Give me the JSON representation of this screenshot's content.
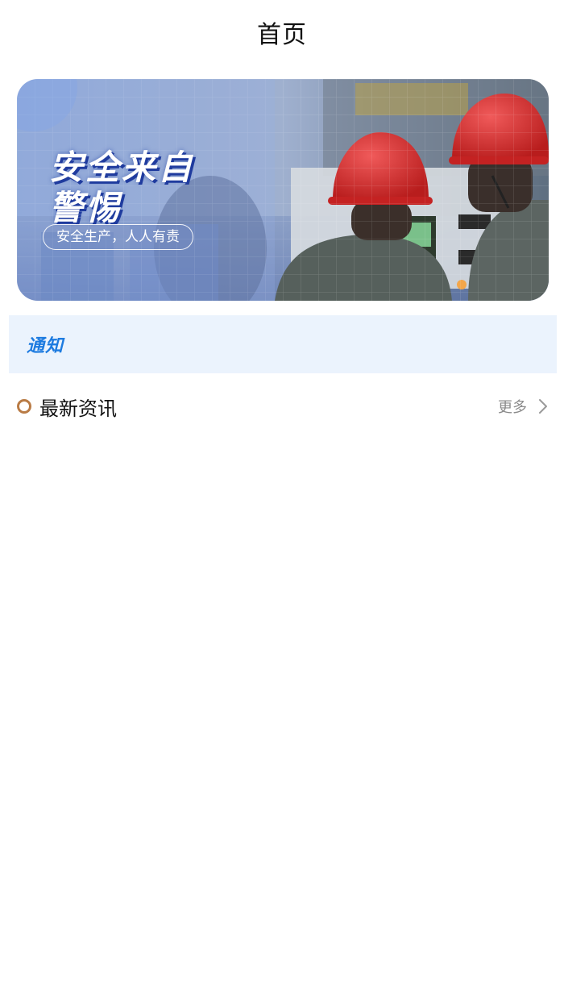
{
  "header": {
    "title": "首页"
  },
  "banner": {
    "title_line1": "安全来自",
    "title_line2": "警惕",
    "slogan": "安全生产，人人有责"
  },
  "notice": {
    "label": "通知"
  },
  "news": {
    "title": "最新资讯",
    "more_label": "更多"
  },
  "colors": {
    "notice_bg": "#ebf3fd",
    "notice_text": "#1d7be0",
    "bullet": "#b97b45",
    "helmet": "#d92b2b"
  },
  "icons": {
    "bullet": "circle-outline-icon",
    "more": "chevron-right-icon"
  }
}
